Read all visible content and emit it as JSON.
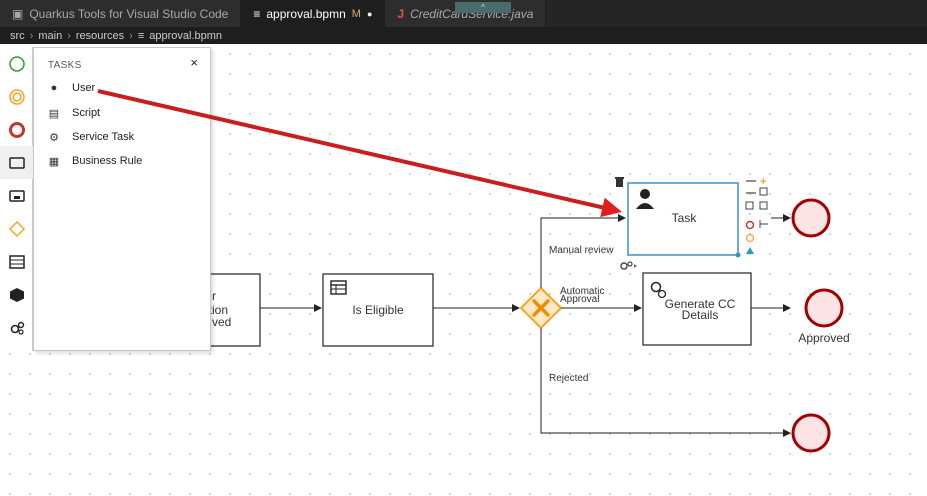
{
  "tabs": [
    {
      "icon": "quarkus-icon",
      "label": "Quarkus Tools for Visual Studio Code",
      "active": false
    },
    {
      "icon": "bpmn-file-icon",
      "label": "approval.bpmn",
      "modified": "M",
      "active": true
    },
    {
      "icon": "java-icon",
      "label": "CreditCardService.java",
      "active": false
    }
  ],
  "tab_ext_glyph": "^",
  "breadcrumb": [
    "src",
    "main",
    "resources",
    "approval.bpmn"
  ],
  "palette": [
    {
      "name": "start-event",
      "icon": "circle-thin"
    },
    {
      "name": "intermediate-event",
      "icon": "circle-double"
    },
    {
      "name": "end-event",
      "icon": "circle-thick"
    },
    {
      "name": "task",
      "icon": "rectangle",
      "selected": true
    },
    {
      "name": "subprocess",
      "icon": "subprocess"
    },
    {
      "name": "gateway",
      "icon": "diamond"
    },
    {
      "name": "container",
      "icon": "lane"
    },
    {
      "name": "custom-tasks",
      "icon": "cube"
    },
    {
      "name": "service-tasks",
      "icon": "gears"
    }
  ],
  "popover": {
    "title": "TASKS",
    "close": "×",
    "items": [
      {
        "label": "User",
        "icon": "user-icon"
      },
      {
        "label": "Script",
        "icon": "script-icon"
      },
      {
        "label": "Service Task",
        "icon": "service-task-icon"
      },
      {
        "label": "Business Rule",
        "icon": "business-rule-icon"
      }
    ]
  },
  "diagram": {
    "partial_node_text": [
      "r",
      "ition",
      "ved"
    ],
    "is_eligible": "Is Eligible",
    "task": "Task",
    "generate_cc": [
      "Generate CC",
      "Details"
    ],
    "manual_review": "Manual review",
    "automatic_approval": [
      "Automatic",
      "Approval"
    ],
    "rejected": "Rejected",
    "approved": "Approved"
  },
  "colors": {
    "arrow": "#e02020",
    "gateway": "#f5a623",
    "end_event_fill": "#fde4e4",
    "end_event_stroke": "#a30000",
    "selection": "#3a8fd6"
  }
}
